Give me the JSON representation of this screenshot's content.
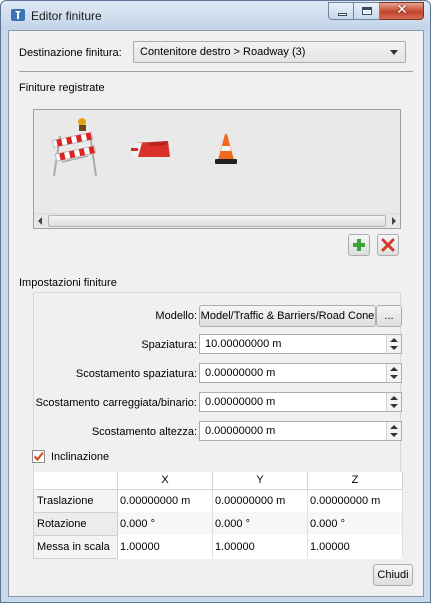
{
  "window": {
    "title": "Editor finiture"
  },
  "destination": {
    "label": "Destinazione finitura:",
    "value": "Contenitore destro > Roadway (3)"
  },
  "registered": {
    "section_label": "Finiture registrate",
    "items": [
      {
        "icon": "traffic-barricade-with-light-icon"
      },
      {
        "icon": "jersey-barrier-icon"
      },
      {
        "icon": "traffic-cone-icon"
      }
    ],
    "add_icon": "plus-icon",
    "remove_icon": "red-x-icon"
  },
  "settings": {
    "section_label": "Impostazioni finiture",
    "model": {
      "label": "Modello:",
      "value": "Model/Traffic & Barriers/Road Cone",
      "browse_label": "..."
    },
    "spacing": {
      "label": "Spaziatura:",
      "value": "10.00000000 m"
    },
    "spacing_offset": {
      "label": "Scostamento spaziatura:",
      "value": "0.00000000 m"
    },
    "road_offset": {
      "label": "Scostamento carreggiata/binario:",
      "value": "0.00000000 m"
    },
    "height_offset": {
      "label": "Scostamento altezza:",
      "value": "0.00000000 m"
    },
    "incline": {
      "label": "Inclinazione",
      "checked": true
    },
    "transform_table": {
      "columns": [
        "",
        "X",
        "Y",
        "Z"
      ],
      "rows": [
        {
          "label": "Traslazione",
          "values": [
            "0.00000000 m",
            "0.00000000 m",
            "0.00000000 m"
          ]
        },
        {
          "label": "Rotazione",
          "values": [
            "0.000 °",
            "0.000 °",
            "0.000 °"
          ]
        },
        {
          "label": "Messa in scala",
          "values": [
            "1.00000",
            "1.00000",
            "1.00000"
          ]
        }
      ]
    }
  },
  "footer": {
    "close_label": "Chiudi"
  },
  "colors": {
    "check_mark": "#e04a1a",
    "add_green": "#3aa33a",
    "remove_red": "#d23a2a"
  }
}
